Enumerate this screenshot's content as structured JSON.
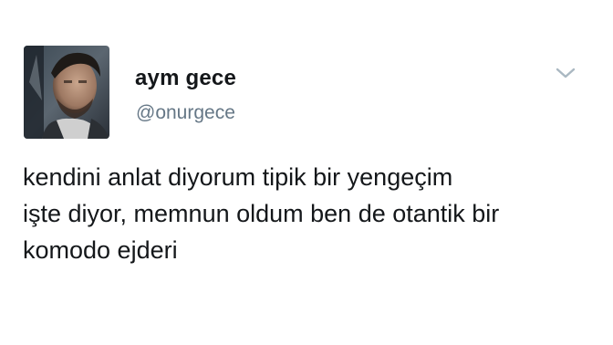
{
  "tweet": {
    "author": {
      "display_name": "aym gece",
      "handle": "@onurgece",
      "avatar_icon": "profile-photo"
    },
    "menu_icon": "chevron-down-icon",
    "text_lines": [
      "kendini anlat diyorum tipik bir yengeçim",
      "işte diyor, memnun oldum ben de otantik bir",
      "komodo ejderi"
    ]
  },
  "colors": {
    "text": "#14171a",
    "handle": "#657786",
    "caret": "#aab8c2",
    "background": "#ffffff"
  }
}
